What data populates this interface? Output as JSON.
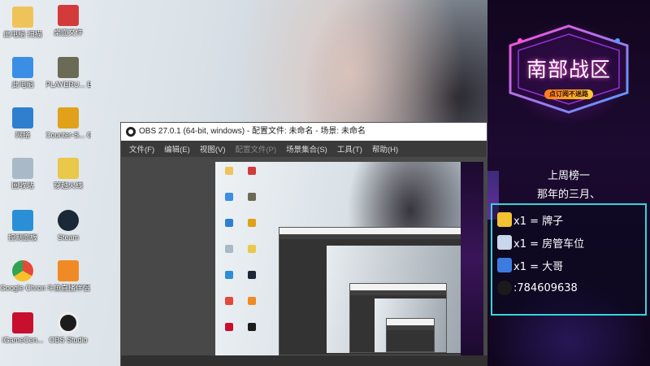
{
  "desktop": {
    "icons": [
      {
        "label": "此电脑 扫描",
        "color": "#f0c35a"
      },
      {
        "label": "桌面文件",
        "color": "#d33a3a"
      },
      {
        "label": "此电脑",
        "color": "#3a8ee6"
      },
      {
        "label": "PLAYERU... BATTLEGR...",
        "color": "#6b6b55"
      },
      {
        "label": "网络",
        "color": "#2f7fd0"
      },
      {
        "label": "Counter-S... Global Off...",
        "color": "#e0a21a"
      },
      {
        "label": "回收站",
        "color": "#a9b9c7"
      },
      {
        "label": "穿越火线",
        "color": "#e9c84a"
      },
      {
        "label": "控制面板",
        "color": "#2b8fd8"
      },
      {
        "label": "Steam",
        "color": "#1b2838"
      },
      {
        "label": "Google Chrome",
        "color": "#e5493a"
      },
      {
        "label": "斗鱼直播伴侣",
        "color": "#f08a24"
      },
      {
        "label": "iGameCen...",
        "color": "#c8102e"
      },
      {
        "label": "OBS Studio",
        "color": "#1c1c1c"
      }
    ]
  },
  "obs": {
    "title": "OBS 27.0.1 (64-bit, windows) - 配置文件: 未命名 - 场景: 未命名",
    "menu": [
      {
        "label": "文件(F)",
        "disabled": false
      },
      {
        "label": "编辑(E)",
        "disabled": false
      },
      {
        "label": "视图(V)",
        "disabled": false
      },
      {
        "label": "配置文件(P)",
        "disabled": true
      },
      {
        "label": "场景集合(S)",
        "disabled": false
      },
      {
        "label": "工具(T)",
        "disabled": false
      },
      {
        "label": "帮助(H)",
        "disabled": false
      }
    ]
  },
  "banner": {
    "emblem_title": "南部战区",
    "emblem_subtitle": "点订阅不迷路",
    "weekly_title": "上周榜一",
    "weekly_name": "那年的三月、",
    "ranks": [
      {
        "icon": "badge-icon",
        "icon_color": "#f2c230",
        "text": "x1 = 牌子"
      },
      {
        "icon": "rocket-icon",
        "icon_color": "#c9d6ec",
        "text": "x1 = 房管车位"
      },
      {
        "icon": "ship-icon",
        "icon_color": "#3c7be0",
        "text": "x1 = 大哥"
      },
      {
        "icon": "qq-icon",
        "icon_color": "#1a1a1a",
        "text": ":784609638"
      }
    ]
  }
}
